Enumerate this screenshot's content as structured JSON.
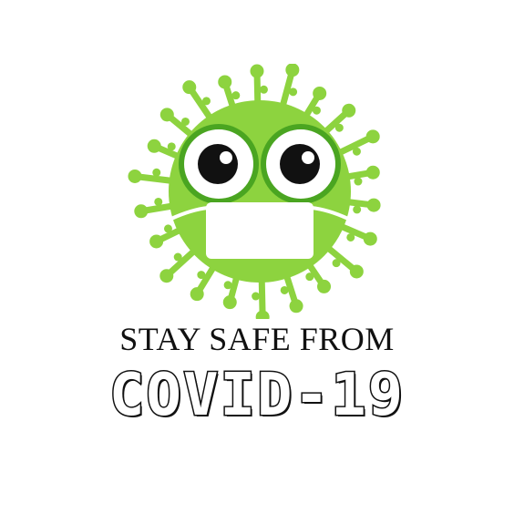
{
  "poster": {
    "tagline": "STAY SAFE FROM",
    "headline": "COVID-19"
  },
  "colors": {
    "virus_green": "#8dd33f",
    "virus_outline": "#4aa521",
    "mask_white": "#ffffff",
    "eye_black": "#111111",
    "text": "#111111"
  },
  "icons": {
    "virus": "masked-virus-cartoon-icon"
  }
}
